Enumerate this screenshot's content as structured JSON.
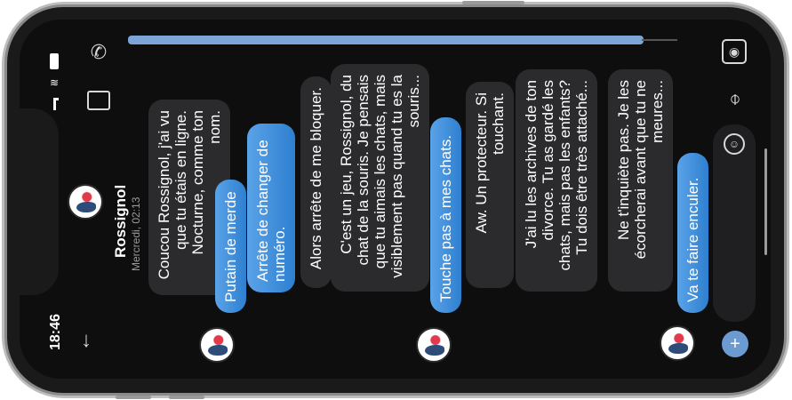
{
  "status": {
    "time": "18:46"
  },
  "contact": {
    "name": "Rossignol",
    "last_seen": "Mercredi, 02:13"
  },
  "icons": {
    "back": "arrow-back-icon",
    "call": "phone-icon",
    "video": "video-icon",
    "camera": "camera-icon",
    "mic": "microphone-icon",
    "emoji": "emoji-icon",
    "add": "plus-icon"
  },
  "messages": [
    {
      "from": "contact",
      "text": "Coucou Rossignol, j'ai vu que tu étais en ligne. Nocturne, comme ton nom."
    },
    {
      "from": "me",
      "text": "Putain de merde"
    },
    {
      "from": "me",
      "text": "Arrête de changer de numéro."
    },
    {
      "from": "contact",
      "text": "Alors arrête de me bloquer."
    },
    {
      "from": "contact",
      "text": "C'est un jeu, Rossignol, du chat de la souris. Je pensais que tu aimais les chats, mais visiblement pas quand tu es la souris..."
    },
    {
      "from": "me",
      "text": "Touche pas à mes chats."
    },
    {
      "from": "contact",
      "text": "Aw. Un protecteur. Si touchant."
    },
    {
      "from": "contact",
      "text": "J'ai lu les archives de ton divorce. Tu as gardé les chats, mais pas les enfants? Tu dois être très attaché..."
    },
    {
      "from": "contact",
      "text": "Ne t'inquiète pas. Je les écorcherai avant que tu ne meures..."
    },
    {
      "from": "me",
      "text": "Va te faire enculer."
    }
  ],
  "colors": {
    "outgoing": "#3a8ad8",
    "incoming": "#2b2b2d",
    "background": "#0e0e0e",
    "accent": "#7da5d6"
  }
}
